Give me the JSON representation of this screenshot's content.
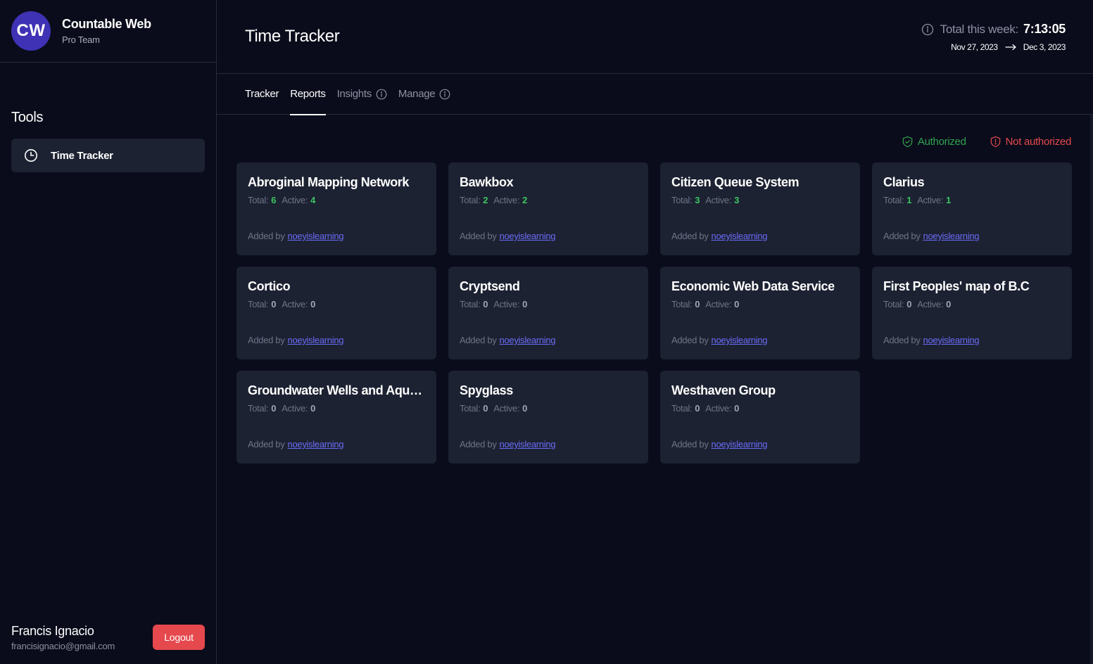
{
  "sidebar": {
    "avatar_initials": "CW",
    "org_name": "Countable Web",
    "org_plan": "Pro Team",
    "tools_heading": "Tools",
    "tool_item_label": "Time Tracker",
    "user_name": "Francis Ignacio",
    "user_email": "francisignacio@gmail.com",
    "logout_label": "Logout"
  },
  "header": {
    "title": "Time Tracker",
    "week_label": "Total this week:",
    "week_value": "7:13:05",
    "range_start": "Nov 27, 2023",
    "range_end": "Dec 3, 2023"
  },
  "tabs": [
    {
      "label": "Tracker"
    },
    {
      "label": "Reports"
    },
    {
      "label": "Insights"
    },
    {
      "label": "Manage"
    }
  ],
  "legend": {
    "authorized": "Authorized",
    "not_authorized": "Not authorized"
  },
  "card_labels": {
    "total": "Total:",
    "active": "Active:",
    "added_by": "Added by"
  },
  "cards": [
    {
      "title": "Abroginal Mapping Network",
      "total": "6",
      "active": "4",
      "user": "noeyislearning"
    },
    {
      "title": "Bawkbox",
      "total": "2",
      "active": "2",
      "user": "noeyislearning"
    },
    {
      "title": "Citizen Queue System",
      "total": "3",
      "active": "3",
      "user": "noeyislearning"
    },
    {
      "title": "Clarius",
      "total": "1",
      "active": "1",
      "user": "noeyislearning"
    },
    {
      "title": "Cortico",
      "total": "0",
      "active": "0",
      "user": "noeyislearning"
    },
    {
      "title": "Cryptsend",
      "total": "0",
      "active": "0",
      "user": "noeyislearning"
    },
    {
      "title": "Economic Web Data Service",
      "total": "0",
      "active": "0",
      "user": "noeyislearning"
    },
    {
      "title": "First Peoples' map of B.C",
      "total": "0",
      "active": "0",
      "user": "noeyislearning"
    },
    {
      "title": "Groundwater Wells and Aquifers",
      "total": "0",
      "active": "0",
      "user": "noeyislearning"
    },
    {
      "title": "Spyglass",
      "total": "0",
      "active": "0",
      "user": "noeyislearning"
    },
    {
      "title": "Westhaven Group",
      "total": "0",
      "active": "0",
      "user": "noeyislearning"
    }
  ],
  "colors": {
    "background": "#0a0c1b",
    "card": "#1c2232",
    "accent_avatar": "#3f32b5",
    "positive": "#3cc45f",
    "authorized": "#2fa34f",
    "danger": "#e5484d",
    "link": "#6b6af5"
  },
  "icons": {
    "tool_item": "clock-icon",
    "week_info": "info-icon",
    "tab_info": "info-icon",
    "authorized": "shield-check-icon",
    "not_authorized": "shield-alert-icon"
  }
}
